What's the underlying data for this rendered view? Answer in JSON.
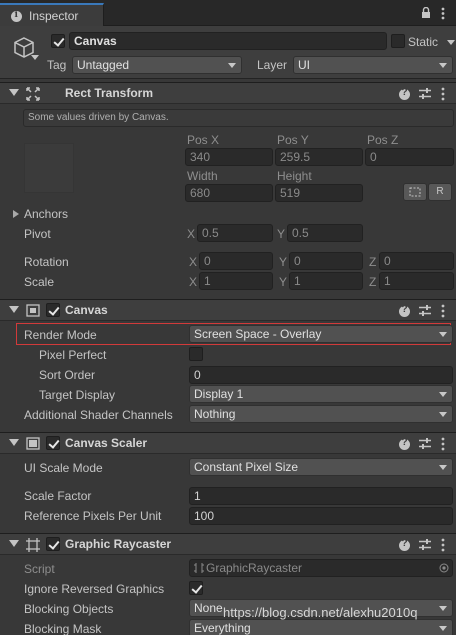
{
  "tab": {
    "title": "Inspector"
  },
  "gameobject": {
    "active": true,
    "name": "Canvas",
    "static_label": "Static",
    "tag_label": "Tag",
    "tag_value": "Untagged",
    "layer_label": "Layer",
    "layer_value": "UI"
  },
  "rect_transform": {
    "title": "Rect Transform",
    "driven_note": "Some values driven by Canvas.",
    "pos_x_label": "Pos X",
    "pos_y_label": "Pos Y",
    "pos_z_label": "Pos Z",
    "pos_x": "340",
    "pos_y": "259.5",
    "pos_z": "0",
    "width_label": "Width",
    "height_label": "Height",
    "width": "680",
    "height": "519",
    "r_button": "R",
    "anchors_label": "Anchors",
    "pivot_label": "Pivot",
    "pivot_x": "0.5",
    "pivot_y": "0.5",
    "rotation_label": "Rotation",
    "rot_x": "0",
    "rot_y": "0",
    "rot_z": "0",
    "scale_label": "Scale",
    "scale_x": "1",
    "scale_y": "1",
    "scale_z": "1",
    "x": "X",
    "y": "Y",
    "z": "Z"
  },
  "canvas": {
    "title": "Canvas",
    "enabled": true,
    "render_mode_label": "Render Mode",
    "render_mode_value": "Screen Space - Overlay",
    "pixel_perfect_label": "Pixel Perfect",
    "pixel_perfect": false,
    "sort_order_label": "Sort Order",
    "sort_order": "0",
    "target_display_label": "Target Display",
    "target_display": "Display 1",
    "shader_channels_label": "Additional Shader Channels",
    "shader_channels": "Nothing"
  },
  "canvas_scaler": {
    "title": "Canvas Scaler",
    "enabled": true,
    "ui_scale_mode_label": "UI Scale Mode",
    "ui_scale_mode": "Constant Pixel Size",
    "scale_factor_label": "Scale Factor",
    "scale_factor": "1",
    "ref_ppu_label": "Reference Pixels Per Unit",
    "ref_ppu": "100"
  },
  "graphic_raycaster": {
    "title": "Graphic Raycaster",
    "enabled": true,
    "script_label": "Script",
    "script_value": "GraphicRaycaster",
    "ignore_reversed_label": "Ignore Reversed Graphics",
    "ignore_reversed": true,
    "blocking_objects_label": "Blocking Objects",
    "blocking_objects": "None",
    "blocking_mask_label": "Blocking Mask",
    "blocking_mask": "Everything"
  },
  "watermark": "https://blog.csdn.net/alexhu2010q",
  "colors": {
    "highlight": "#d23a3a",
    "accent_tab": "#3a79bb",
    "background": "#383838"
  }
}
